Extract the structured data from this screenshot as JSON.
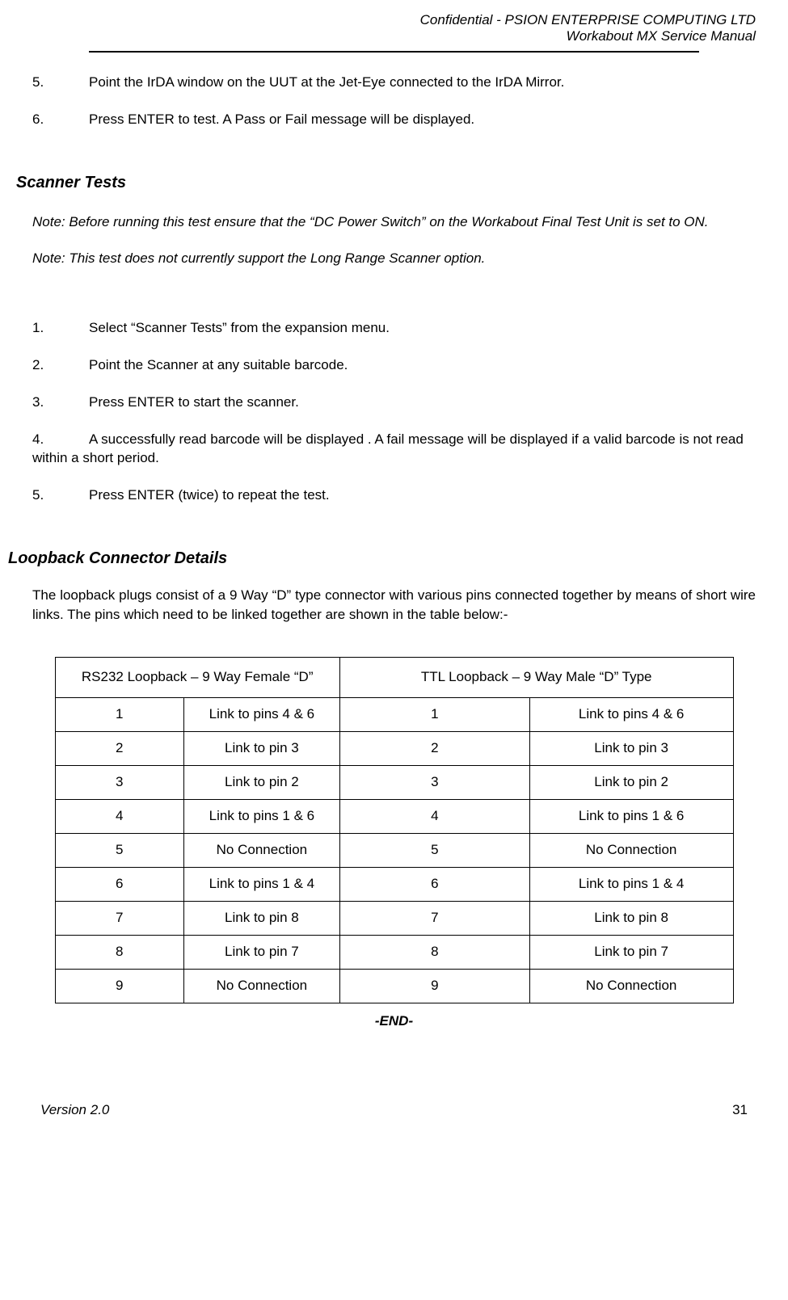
{
  "header": {
    "confidential": "Confidential - PSION ENTERPRISE COMPUTING LTD",
    "doc_title": "Workabout MX Service Manual"
  },
  "top_steps": [
    {
      "num": "5.",
      "text": "Point the IrDA window on the UUT at the Jet-Eye connected to the IrDA Mirror."
    },
    {
      "num": "6.",
      "text": "Press ENTER to test.  A Pass or Fail message will be displayed."
    }
  ],
  "scanner": {
    "heading": "Scanner Tests",
    "note1": "Note: Before running this test ensure that the “DC Power Switch” on the Workabout Final Test Unit is set to ON.",
    "note2": "Note: This test does not currently support the Long Range Scanner option.",
    "steps": [
      {
        "num": "1.",
        "text": "Select “Scanner Tests” from the expansion menu."
      },
      {
        "num": "2.",
        "text": "Point the Scanner at any suitable barcode."
      },
      {
        "num": "3.",
        "text": "Press ENTER to start the scanner."
      },
      {
        "num": "4.",
        "text": "A successfully read barcode will be displayed .  A fail message will be displayed if a valid barcode is not read within a short period."
      },
      {
        "num": "5.",
        "text": "Press ENTER (twice) to repeat the test."
      }
    ]
  },
  "loopback": {
    "heading": "Loopback Connector Details",
    "intro": "The loopback plugs consist of a 9 Way “D” type connector with various pins connected together by means of short wire links.  The pins which need to be linked together are shown in the table below:-",
    "head_left": "RS232 Loopback – 9 Way Female “D”",
    "head_right": "TTL Loopback – 9 Way Male “D” Type",
    "rows": [
      {
        "l1": "1",
        "l2": "Link to pins 4 & 6",
        "r1": "1",
        "r2": "Link to pins 4 & 6"
      },
      {
        "l1": "2",
        "l2": "Link to pin 3",
        "r1": "2",
        "r2": "Link to pin 3"
      },
      {
        "l1": "3",
        "l2": "Link to pin 2",
        "r1": "3",
        "r2": "Link to pin 2"
      },
      {
        "l1": "4",
        "l2": "Link to pins 1 & 6",
        "r1": "4",
        "r2": "Link to pins 1 & 6"
      },
      {
        "l1": "5",
        "l2": "No Connection",
        "r1": "5",
        "r2": "No Connection"
      },
      {
        "l1": "6",
        "l2": "Link to pins 1 & 4",
        "r1": "6",
        "r2": "Link to pins 1 & 4"
      },
      {
        "l1": "7",
        "l2": "Link to pin 8",
        "r1": "7",
        "r2": "Link to pin 8"
      },
      {
        "l1": "8",
        "l2": "Link to pin 7",
        "r1": "8",
        "r2": "Link to pin 7"
      },
      {
        "l1": "9",
        "l2": "No Connection",
        "r1": "9",
        "r2": "No Connection"
      }
    ]
  },
  "end_marker": "-END-",
  "footer": {
    "version": "Version 2.0",
    "page": "31"
  }
}
